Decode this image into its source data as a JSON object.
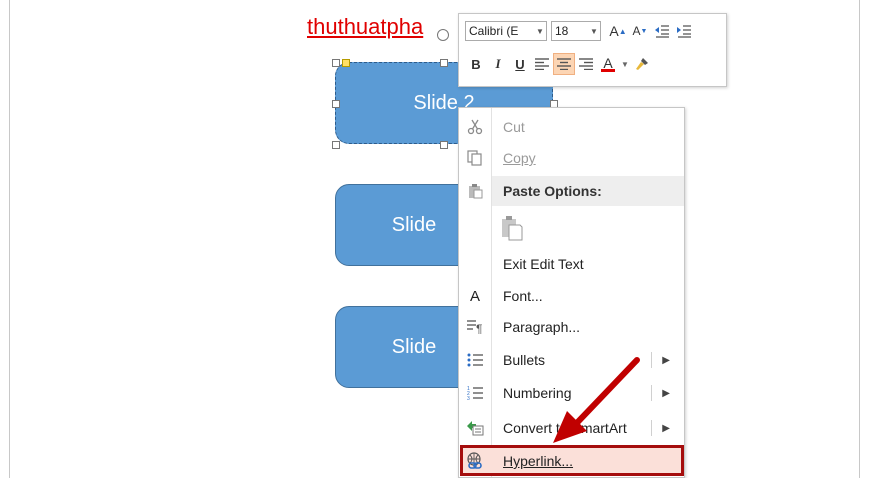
{
  "title_text": "thuthuatpha",
  "shapes": [
    {
      "label": "Slide 2"
    },
    {
      "label": "Slide"
    },
    {
      "label": "Slide"
    }
  ],
  "mini_toolbar": {
    "font_name": "Calibri (E",
    "font_size": "18",
    "grow_font": "A",
    "shrink_font": "A",
    "bold": "B",
    "italic": "I",
    "underline": "U",
    "font_color_letter": "A"
  },
  "context_menu": {
    "cut": "Cut",
    "copy": "Copy",
    "paste_options": "Paste Options:",
    "exit_edit_text": "Exit Edit Text",
    "font": "Font...",
    "paragraph": "Paragraph...",
    "bullets": "Bullets",
    "numbering": "Numbering",
    "convert_smartart": "Convert to SmartArt",
    "hyperlink": "Hyperlink...",
    "font_icon_letter": "A"
  },
  "colors": {
    "shape_fill": "#5b9bd5",
    "title_red": "#e00000",
    "highlight_border": "#a50d0d",
    "arrow": "#c00000"
  }
}
